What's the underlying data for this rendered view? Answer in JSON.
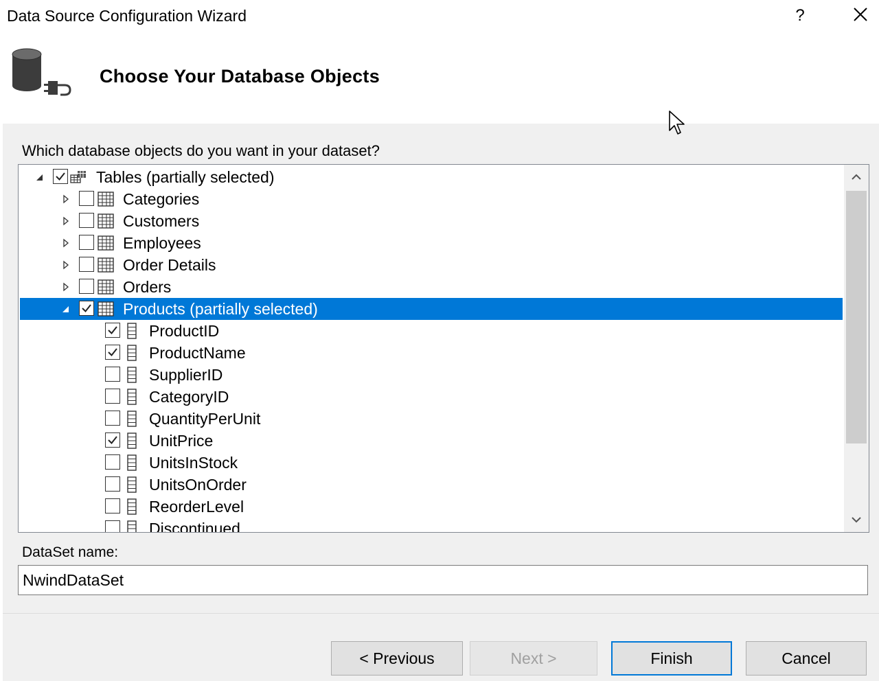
{
  "window": {
    "title": "Data Source Configuration Wizard",
    "help_label": "?"
  },
  "header": {
    "title": "Choose Your Database Objects",
    "icon": "database-connection-icon"
  },
  "main": {
    "question": "Which database objects do you want in your dataset?",
    "tree": {
      "root": {
        "label": "Tables (partially selected)",
        "checked": true,
        "expanded": true
      },
      "tables": [
        {
          "label": "Categories",
          "checked": false,
          "expanded": false
        },
        {
          "label": "Customers",
          "checked": false,
          "expanded": false
        },
        {
          "label": "Employees",
          "checked": false,
          "expanded": false
        },
        {
          "label": "Order Details",
          "checked": false,
          "expanded": false
        },
        {
          "label": "Orders",
          "checked": false,
          "expanded": false
        },
        {
          "label": "Products (partially selected)",
          "checked": true,
          "expanded": true,
          "selected": true
        }
      ],
      "columns": [
        {
          "label": "ProductID",
          "checked": true
        },
        {
          "label": "ProductName",
          "checked": true
        },
        {
          "label": "SupplierID",
          "checked": false
        },
        {
          "label": "CategoryID",
          "checked": false
        },
        {
          "label": "QuantityPerUnit",
          "checked": false
        },
        {
          "label": "UnitPrice",
          "checked": true
        },
        {
          "label": "UnitsInStock",
          "checked": false
        },
        {
          "label": "UnitsOnOrder",
          "checked": false
        },
        {
          "label": "ReorderLevel",
          "checked": false
        },
        {
          "label": "Discontinued",
          "checked": false
        }
      ]
    },
    "dataset_label": "DataSet name:",
    "dataset_value": "NwindDataSet"
  },
  "footer": {
    "previous": "< Previous",
    "next": "Next >",
    "finish": "Finish",
    "cancel": "Cancel"
  },
  "colors": {
    "selection": "#0078d7",
    "panel": "#f0f0f0"
  }
}
